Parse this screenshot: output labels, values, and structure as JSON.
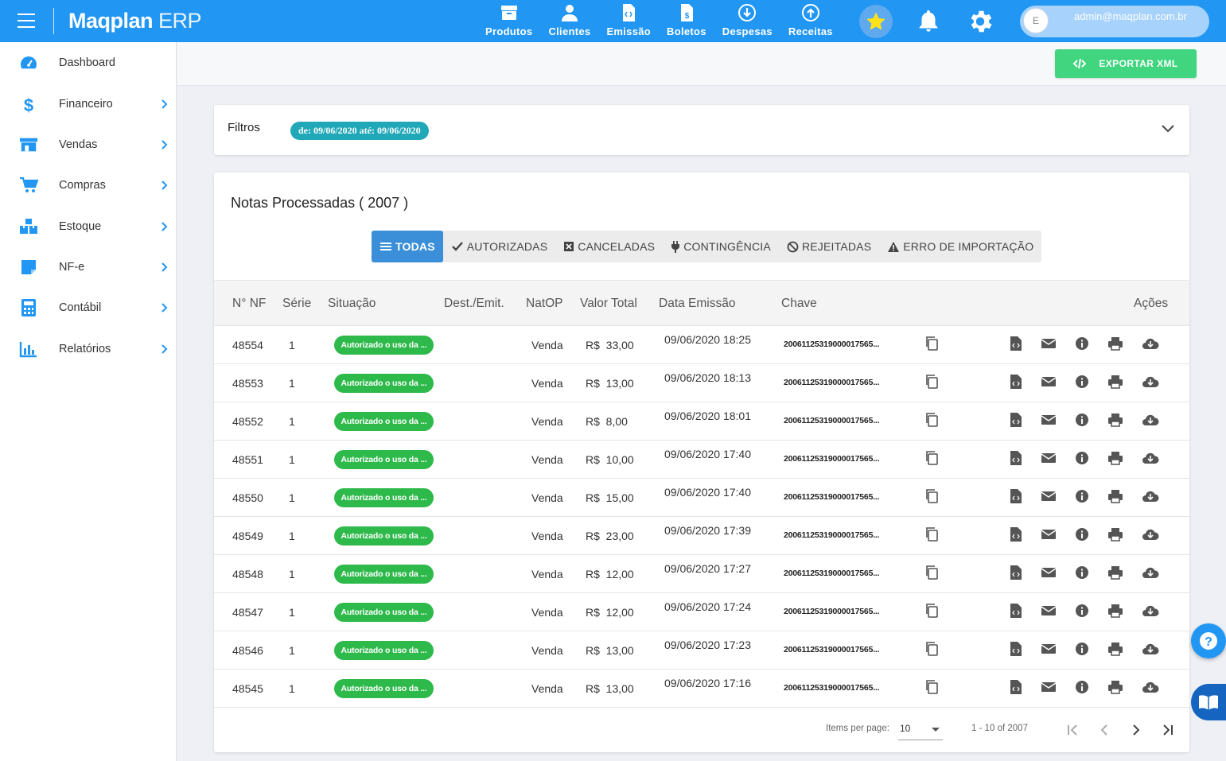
{
  "header": {
    "brand": "Maqplan",
    "brand_suffix": "ERP",
    "nav": [
      {
        "label": "Produtos",
        "icon": "box-icon"
      },
      {
        "label": "Clientes",
        "icon": "user-icon"
      },
      {
        "label": "Emissão",
        "icon": "code-file-icon"
      },
      {
        "label": "Boletos",
        "icon": "dollar-file-icon"
      },
      {
        "label": "Despesas",
        "icon": "arrow-down-circle-icon"
      },
      {
        "label": "Receitas",
        "icon": "arrow-up-circle-icon"
      }
    ],
    "avatar_letter": "E",
    "user_email": "admin@maqplan.com.br"
  },
  "sidebar": {
    "items": [
      {
        "label": "Dashboard",
        "icon": "speedometer-icon",
        "has_children": false
      },
      {
        "label": "Financeiro",
        "icon": "dollar-icon",
        "has_children": true
      },
      {
        "label": "Vendas",
        "icon": "store-icon",
        "has_children": true
      },
      {
        "label": "Compras",
        "icon": "cart-icon",
        "has_children": true
      },
      {
        "label": "Estoque",
        "icon": "boxes-icon",
        "has_children": true
      },
      {
        "label": "NF-e",
        "icon": "note-icon",
        "has_children": true
      },
      {
        "label": "Contábil",
        "icon": "calculator-icon",
        "has_children": true
      },
      {
        "label": "Relatórios",
        "icon": "bar-chart-icon",
        "has_children": true
      }
    ]
  },
  "toolbar": {
    "export_label": "EXPORTAR XML"
  },
  "filters": {
    "title": "Filtros",
    "date_chip": "de: 09/06/2020 até: 09/06/2020"
  },
  "notes": {
    "title": "Notas Processadas ( 2007 )",
    "tabs": [
      {
        "label": "TODAS",
        "icon": "list-icon",
        "active": true
      },
      {
        "label": "AUTORIZADAS",
        "icon": "check-icon",
        "active": false
      },
      {
        "label": "CANCELADAS",
        "icon": "x-square-icon",
        "active": false
      },
      {
        "label": "CONTINGÊNCIA",
        "icon": "plug-icon",
        "active": false
      },
      {
        "label": "REJEITADAS",
        "icon": "ban-icon",
        "active": false
      },
      {
        "label": "ERRO DE IMPORTAÇÃO",
        "icon": "warning-icon",
        "active": false
      }
    ],
    "columns": {
      "nf": "N° NF",
      "serie": "Série",
      "situacao": "Situação",
      "dest": "Dest./Emit.",
      "natop": "NatOP",
      "valor": "Valor Total",
      "data": "Data Emissão",
      "chave": "Chave",
      "acoes": "Ações"
    },
    "rows": [
      {
        "nf": "48554",
        "serie": "1",
        "status": "Autorizado o uso da ...",
        "dest": "",
        "natop": "Venda",
        "valor": "R$  33,00",
        "data": "09/06/2020 18:25",
        "chave": "2006112531900001756​5..."
      },
      {
        "nf": "48553",
        "serie": "1",
        "status": "Autorizado o uso da ...",
        "dest": "",
        "natop": "Venda",
        "valor": "R$  13,00",
        "data": "09/06/2020 18:13",
        "chave": "20061125319000017565..."
      },
      {
        "nf": "48552",
        "serie": "1",
        "status": "Autorizado o uso da ...",
        "dest": "",
        "natop": "Venda",
        "valor": "R$  8,00",
        "data": "09/06/2020 18:01",
        "chave": "20061125319000017565..."
      },
      {
        "nf": "48551",
        "serie": "1",
        "status": "Autorizado o uso da ...",
        "dest": "",
        "natop": "Venda",
        "valor": "R$  10,00",
        "data": "09/06/2020 17:40",
        "chave": "20061125319000017565..."
      },
      {
        "nf": "48550",
        "serie": "1",
        "status": "Autorizado o uso da ...",
        "dest": "",
        "natop": "Venda",
        "valor": "R$  15,00",
        "data": "09/06/2020 17:40",
        "chave": "20061125319000017565..."
      },
      {
        "nf": "48549",
        "serie": "1",
        "status": "Autorizado o uso da ...",
        "dest": "",
        "natop": "Venda",
        "valor": "R$  23,00",
        "data": "09/06/2020 17:39",
        "chave": "20061125319000017565..."
      },
      {
        "nf": "48548",
        "serie": "1",
        "status": "Autorizado o uso da ...",
        "dest": "",
        "natop": "Venda",
        "valor": "R$  12,00",
        "data": "09/06/2020 17:27",
        "chave": "20061125319000017565..."
      },
      {
        "nf": "48547",
        "serie": "1",
        "status": "Autorizado o uso da ...",
        "dest": "",
        "natop": "Venda",
        "valor": "R$  12,00",
        "data": "09/06/2020 17:24",
        "chave": "20061125319000017565..."
      },
      {
        "nf": "48546",
        "serie": "1",
        "status": "Autorizado o uso da ...",
        "dest": "",
        "natop": "Venda",
        "valor": "R$  13,00",
        "data": "09/06/2020 17:23",
        "chave": "20061125319000017565..."
      },
      {
        "nf": "48545",
        "serie": "1",
        "status": "Autorizado o uso da ...",
        "dest": "",
        "natop": "Venda",
        "valor": "R$  13,00",
        "data": "09/06/2020 17:16",
        "chave": "20061125319000017565..."
      }
    ],
    "row_actions": [
      "copy-icon",
      "xml-file-icon",
      "email-icon",
      "info-icon",
      "print-icon",
      "cloud-download-icon"
    ]
  },
  "pager": {
    "items_label": "Items per page:",
    "page_size": "10",
    "range": "1 - 10 of 2007"
  },
  "colors": {
    "primary": "#2196f3",
    "success": "#2eb94b",
    "export": "#40d57e",
    "chip": "#20a8b8",
    "tab_active": "#3a8fd8"
  }
}
